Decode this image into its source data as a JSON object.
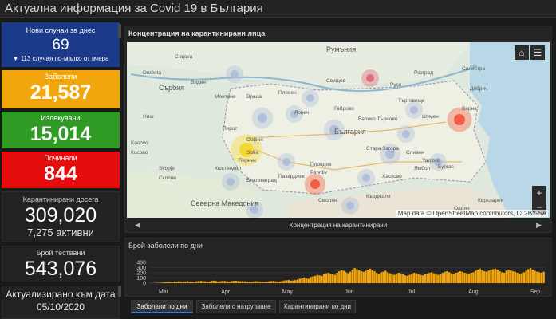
{
  "header": {
    "title": "Актуална информация за Covid 19 в България"
  },
  "tiles": {
    "new_cases": {
      "caption": "Нови случаи за днес",
      "value": "69",
      "note": "▼ 113 случая по-малко от вчера"
    },
    "infected": {
      "caption": "Заболели",
      "value": "21,587"
    },
    "recovered": {
      "caption": "Излекувани",
      "value": "15,014"
    },
    "deaths": {
      "caption": "Починали",
      "value": "844"
    },
    "quarantined": {
      "caption": "Карантинирани досега",
      "value": "309,020",
      "active": "7,275 активни"
    },
    "tests": {
      "caption": "Брой тествани",
      "value": "543,076"
    },
    "updated": {
      "caption": "Актуализирано към дата",
      "date": "05/10/2020"
    }
  },
  "colors": {
    "new_cases": "#1c3a8a",
    "infected": "#f2a60d",
    "recovered": "#2f9b24",
    "deaths": "#e40c0c",
    "bars": "#f2a60d"
  },
  "map": {
    "title": "Концентрация на карантинирани лица",
    "attribution": "Map data © OpenStreetMap contributors, CC-BY-SA",
    "footer_label": "Концентрация на карантинирани",
    "controls": {
      "home": "home-icon",
      "list": "list-icon",
      "zoom_in": "+",
      "zoom_out": "−"
    },
    "places": [
      "Румъния",
      "Сърбия",
      "България",
      "Северна Македония",
      "Kosovo",
      "Косово",
      "Skopje",
      "Скопие",
      "София",
      "Sofia",
      "Пловдив",
      "Plovdiv",
      "Варна",
      "Бургас",
      "Видин",
      "Монтана",
      "Враца",
      "Плевен",
      "Русе",
      "Търговище",
      "Шумен",
      "Добрич",
      "Ловеч",
      "Габрово",
      "Велико Търново",
      "Стара Загора",
      "Хасково",
      "Кърджали",
      "Смолян",
      "Пазарджик",
      "Благоевград",
      "Кюстендил",
      "Перник",
      "Пирот",
      "Ниш",
      "Сливен",
      "Ямбол",
      "Силистра",
      "Разград",
      "Свищов",
      "Кирклареи",
      "Одрин",
      "Crajova",
      "Drobeta",
      "Yambol"
    ]
  },
  "chart": {
    "title": "Брой заболели по дни"
  },
  "tabs": [
    "Заболели по дни",
    "Заболели с натрупване",
    "Карантинирани по дни"
  ],
  "chart_data": {
    "type": "bar",
    "title": "Брой заболели по дни",
    "xlabel": "",
    "ylabel": "",
    "ylim": [
      0,
      400
    ],
    "yticks": [
      0,
      100,
      200,
      300,
      400
    ],
    "month_labels": [
      "Mar",
      "Apr",
      "May",
      "Jun",
      "Jul",
      "Aug",
      "Sep"
    ],
    "series": [
      {
        "values": [
          4,
          3,
          2,
          8,
          7,
          10,
          15,
          20,
          25,
          22,
          18,
          30,
          28,
          35,
          27,
          24,
          33,
          38,
          29,
          30,
          26,
          35,
          40,
          42,
          38,
          36,
          31,
          33,
          45,
          48,
          40,
          32,
          38,
          43,
          39,
          35,
          30,
          42,
          44,
          46,
          40,
          35,
          38,
          34,
          30,
          28,
          26,
          33,
          37,
          36,
          30,
          27,
          25,
          30,
          34,
          38,
          42,
          36,
          30,
          33,
          40,
          52,
          55,
          60,
          48,
          52,
          58,
          70,
          85,
          95,
          110,
          90,
          85,
          120,
          130,
          140,
          160,
          150,
          140,
          170,
          190,
          200,
          180,
          170,
          160,
          200,
          230,
          250,
          240,
          210,
          190,
          220,
          260,
          290,
          270,
          250,
          230,
          220,
          240,
          260,
          280,
          250,
          230,
          200,
          180,
          210,
          220,
          240,
          210,
          190,
          170,
          160,
          180,
          200,
          190,
          170,
          150,
          140,
          160,
          180,
          200,
          190,
          170,
          160,
          150,
          170,
          180,
          200,
          210,
          190,
          180,
          160,
          170,
          200,
          220,
          230,
          210,
          190,
          180,
          200,
          210,
          230,
          220,
          200,
          190,
          180,
          200,
          210,
          240,
          260,
          280,
          250,
          230,
          220,
          240,
          260,
          270,
          280,
          260,
          230,
          210,
          200,
          240,
          260,
          250,
          230,
          220,
          200,
          180,
          190,
          210,
          240,
          270,
          290,
          260,
          240,
          220,
          210,
          200,
          220
        ]
      }
    ]
  }
}
